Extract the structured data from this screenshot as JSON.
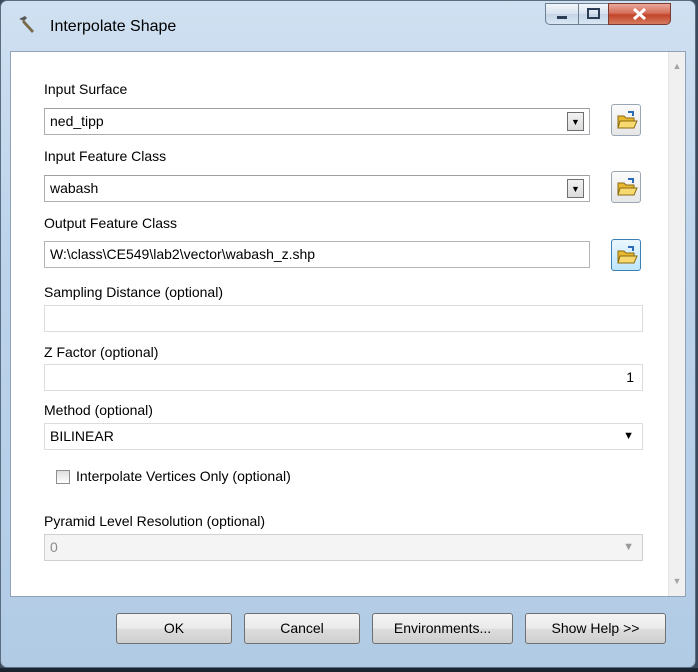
{
  "window": {
    "title": "Interpolate Shape",
    "controls": [
      "minimize-icon",
      "maximize-icon",
      "close-icon"
    ]
  },
  "form": {
    "input_surface": {
      "label": "Input Surface",
      "value": "ned_tipp"
    },
    "input_feature_class": {
      "label": "Input Feature Class",
      "value": "wabash"
    },
    "output_feature_class": {
      "label": "Output Feature Class",
      "value": "W:\\class\\CE549\\lab2\\vector\\wabash_z.shp"
    },
    "sampling_distance": {
      "label": "Sampling Distance (optional)",
      "value": ""
    },
    "z_factor": {
      "label": "Z Factor (optional)",
      "value": "1"
    },
    "method": {
      "label": "Method (optional)",
      "value": "BILINEAR"
    },
    "interpolate_vertices": {
      "label": "Interpolate Vertices Only (optional)",
      "checked": false
    },
    "pyramid_level": {
      "label": "Pyramid Level Resolution (optional)",
      "value": "0"
    }
  },
  "footer": {
    "ok": "OK",
    "cancel": "Cancel",
    "environments": "Environments...",
    "show_help": "Show Help >>"
  },
  "colors": {
    "title_bar": "#bcd3ea",
    "close_button": "#c2442a",
    "folder_icon": "#e8b830"
  }
}
